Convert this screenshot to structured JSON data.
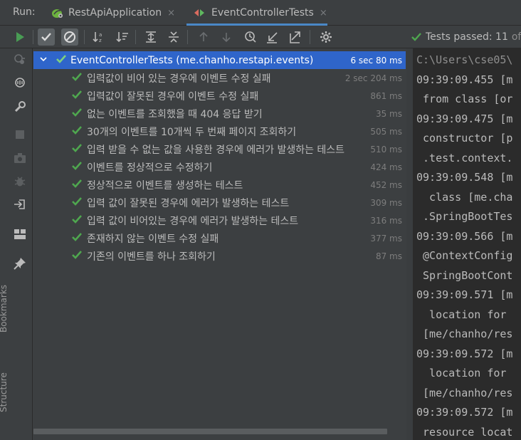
{
  "run_bar": {
    "label": "Run:",
    "tabs": [
      {
        "label": "RestApiApplication",
        "close": "×"
      },
      {
        "label": "EventControllerTests",
        "close": "×"
      }
    ]
  },
  "status": {
    "text": "Tests passed: 11",
    "of": "of"
  },
  "side_labels": {
    "bookmarks": "Bookmarks",
    "structure": "Structure"
  },
  "tree": {
    "root": {
      "name": "EventControllerTests (me.chanho.restapi.events)",
      "time": "6 sec 80 ms"
    },
    "items": [
      {
        "name": "입력값이 비어 있는 경우에 이벤트 수정 실패",
        "time": "2 sec 204 ms"
      },
      {
        "name": "입력값이 잘못된 경우에 이벤트 수정 실패",
        "time": "861 ms"
      },
      {
        "name": "없는 이벤트를 조회했을 때 404 응답 받기",
        "time": "35 ms"
      },
      {
        "name": "30개의 이벤트를 10개씩 두 번째 페이지 조회하기",
        "time": "505 ms"
      },
      {
        "name": "입력 받을 수 없는 값을 사용한 경우에 에러가 발생하는 테스트",
        "time": "510 ms"
      },
      {
        "name": "이벤트를 정상적으로 수정하기",
        "time": "424 ms"
      },
      {
        "name": "정상적으로 이벤트를 생성하는 테스트",
        "time": "452 ms"
      },
      {
        "name": "입력 값이 잘못된 경우에 에러가 발생하는 테스트",
        "time": "309 ms"
      },
      {
        "name": "입력 값이 비어있는 경우에 에러가 발생하는 테스트",
        "time": "316 ms"
      },
      {
        "name": "존재하지 않는 이벤트 수정 실패",
        "time": "377 ms"
      },
      {
        "name": "기존의 이벤트를 하나 조회하기",
        "time": "87 ms"
      }
    ]
  },
  "console": {
    "lines": [
      "C:\\Users\\cse05\\",
      "09:39:09.455 [m",
      " from class [or",
      "09:39:09.475 [m",
      " constructor [p",
      " .test.context.",
      "09:39:09.548 [m",
      "  class [me.cha",
      " .SpringBootTes",
      "09:39:09.566 [m",
      " @ContextConfig",
      " SpringBootCont",
      "09:39:09.571 [m",
      "  location for",
      " [me/chanho/res",
      "09:39:09.572 [m",
      "  location for",
      " [me/chanho/res",
      "09:39:09.572 [m",
      " resource locat"
    ]
  },
  "colors": {
    "accent": "#2f65ca",
    "pass_green": "#4fa74f",
    "tab_underline": "#4a88c7",
    "run_green": "#499c54"
  }
}
